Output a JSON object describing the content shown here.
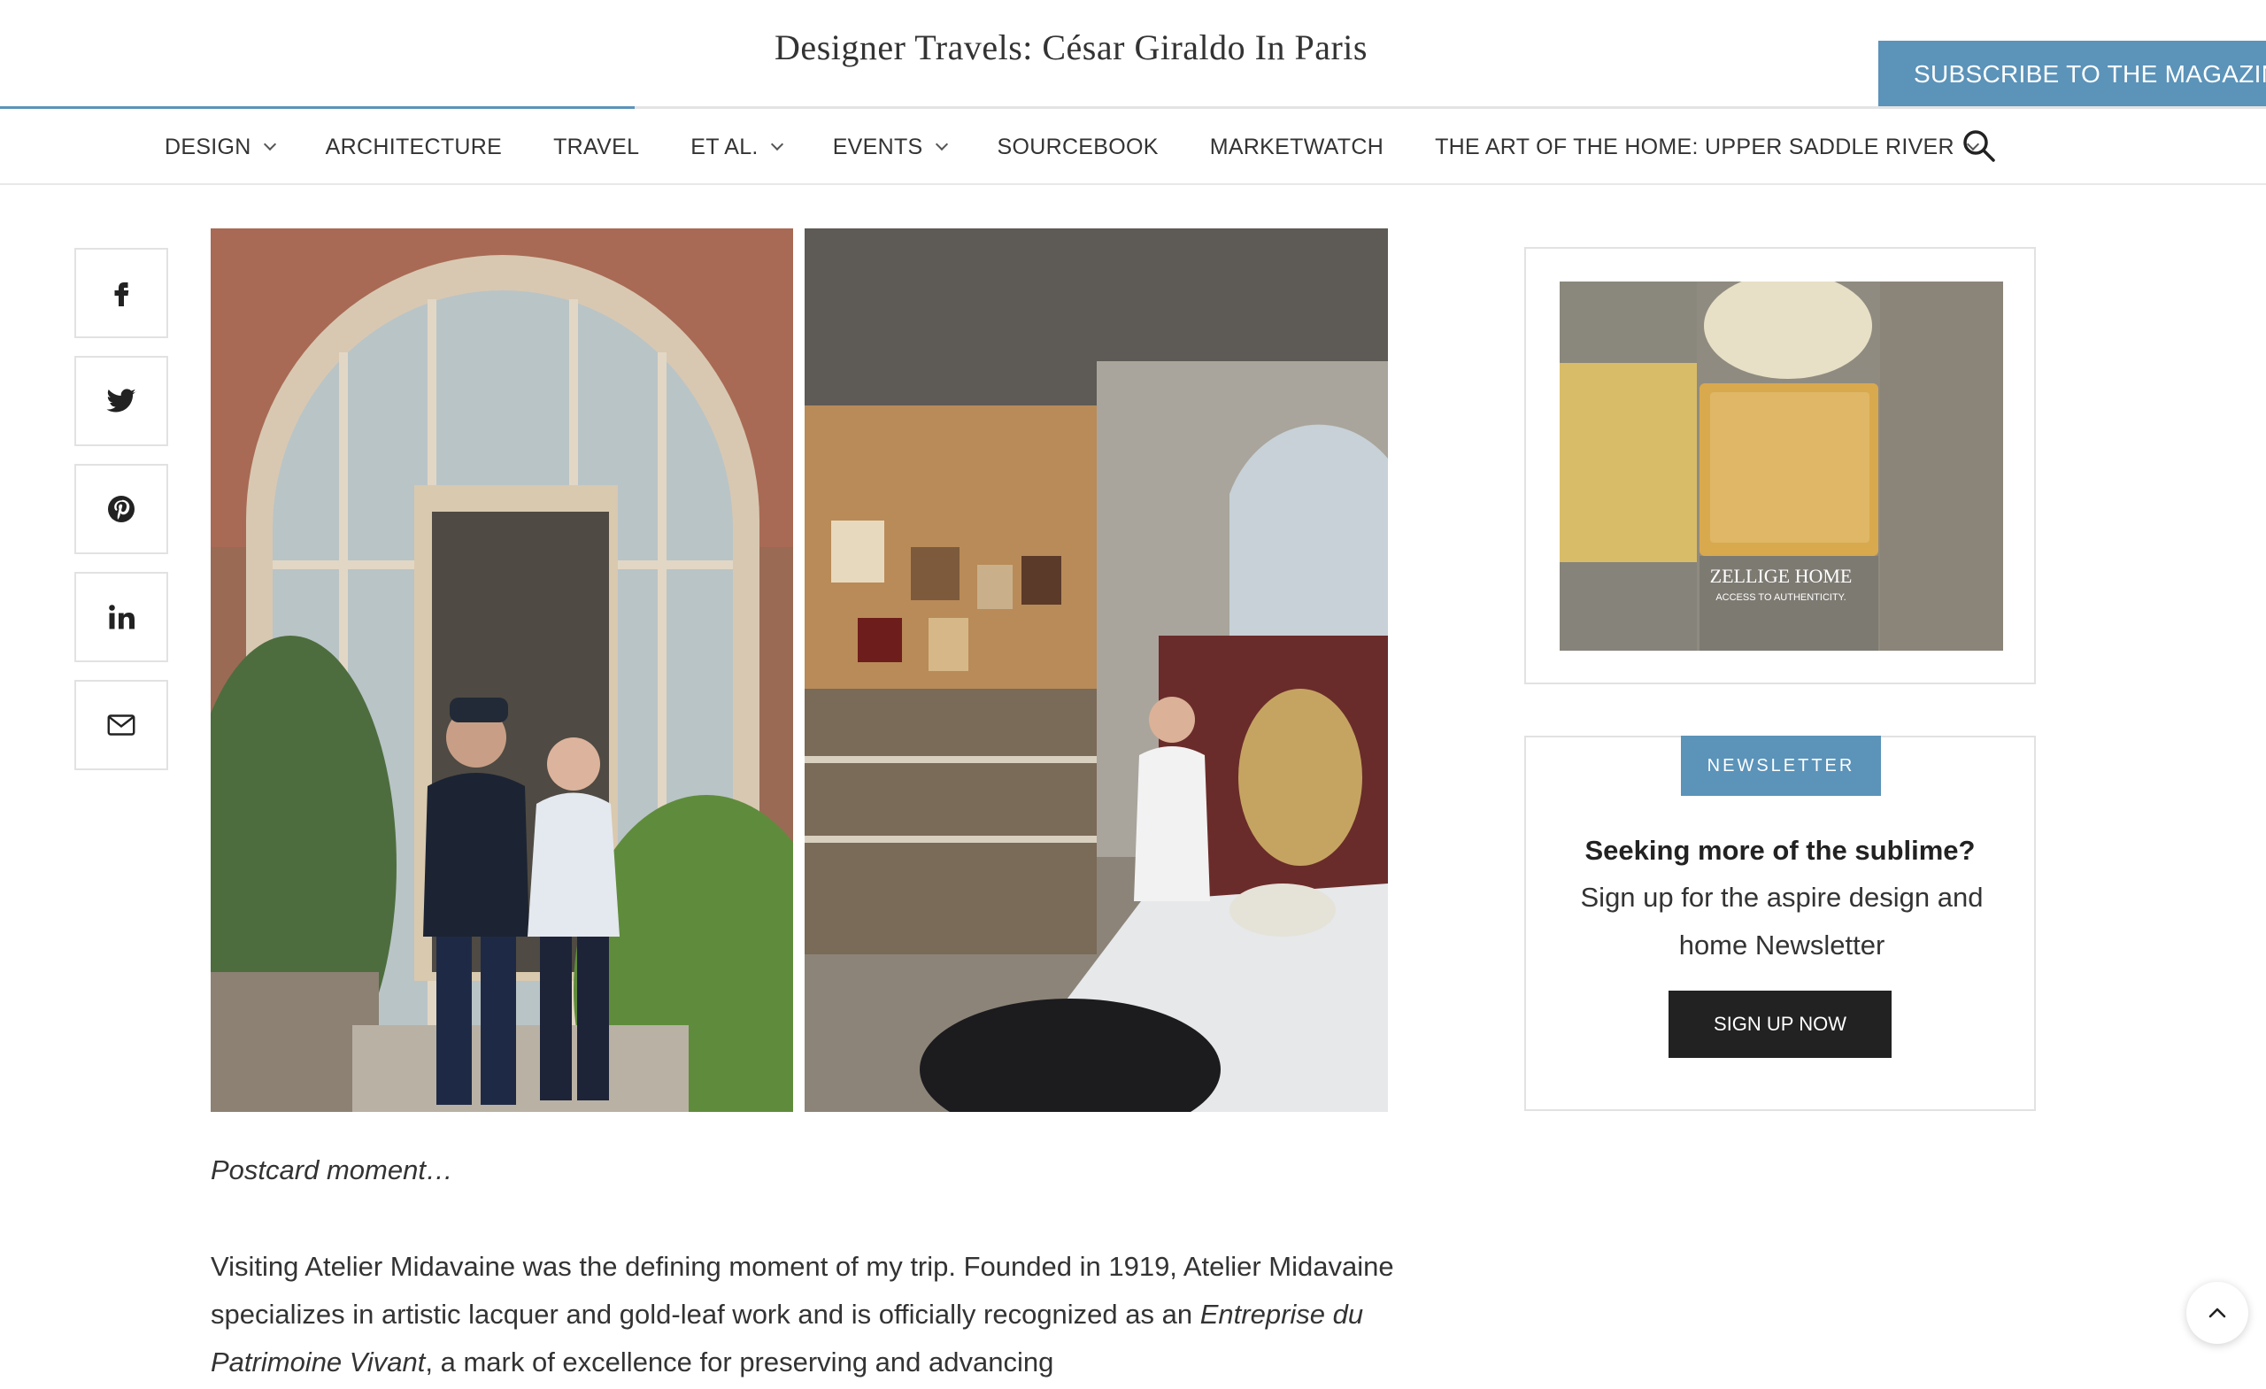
{
  "header": {
    "article_title": "Designer Travels: César Giraldo In Paris",
    "subscribe_label": "SUBSCRIBE TO THE MAGAZINE",
    "reading_progress": 0.28
  },
  "nav": {
    "items": [
      {
        "label": "DESIGN",
        "has_dropdown": true
      },
      {
        "label": "ARCHITECTURE",
        "has_dropdown": false
      },
      {
        "label": "TRAVEL",
        "has_dropdown": false
      },
      {
        "label": "ET AL.",
        "has_dropdown": true
      },
      {
        "label": "EVENTS",
        "has_dropdown": true
      },
      {
        "label": "SOURCEBOOK",
        "has_dropdown": false
      },
      {
        "label": "MARKETWATCH",
        "has_dropdown": false
      },
      {
        "label": "THE ART OF THE HOME: UPPER SADDLE RIVER",
        "has_dropdown": true
      }
    ],
    "search_icon": "search-icon"
  },
  "share": {
    "icons": [
      "facebook-icon",
      "twitter-icon",
      "pinterest-icon",
      "linkedin-icon",
      "email-icon"
    ]
  },
  "article": {
    "caption": "Postcard moment…",
    "paragraph_part1": "Visiting Atelier Midavaine was the defining moment of my trip. Founded in 1919, Atelier Midavaine specializes in artistic lacquer and gold-leaf work and is officially recognized as an ",
    "paragraph_em": "Entreprise du Patrimoine Vivant",
    "paragraph_part2": ", a mark of excellence for preserving and advancing"
  },
  "sidebar": {
    "ad": {
      "brand": "ZELLIGE HOME",
      "tagline": "ACCESS TO AUTHENTICITY."
    },
    "newsletter": {
      "badge": "NEWSLETTER",
      "heading": "Seeking more of the sublime?",
      "text": "Sign up for the aspire design and home Newsletter",
      "button": "SIGN UP NOW"
    }
  },
  "colors": {
    "accent": "#5b93b9",
    "dark_button": "#222222"
  }
}
